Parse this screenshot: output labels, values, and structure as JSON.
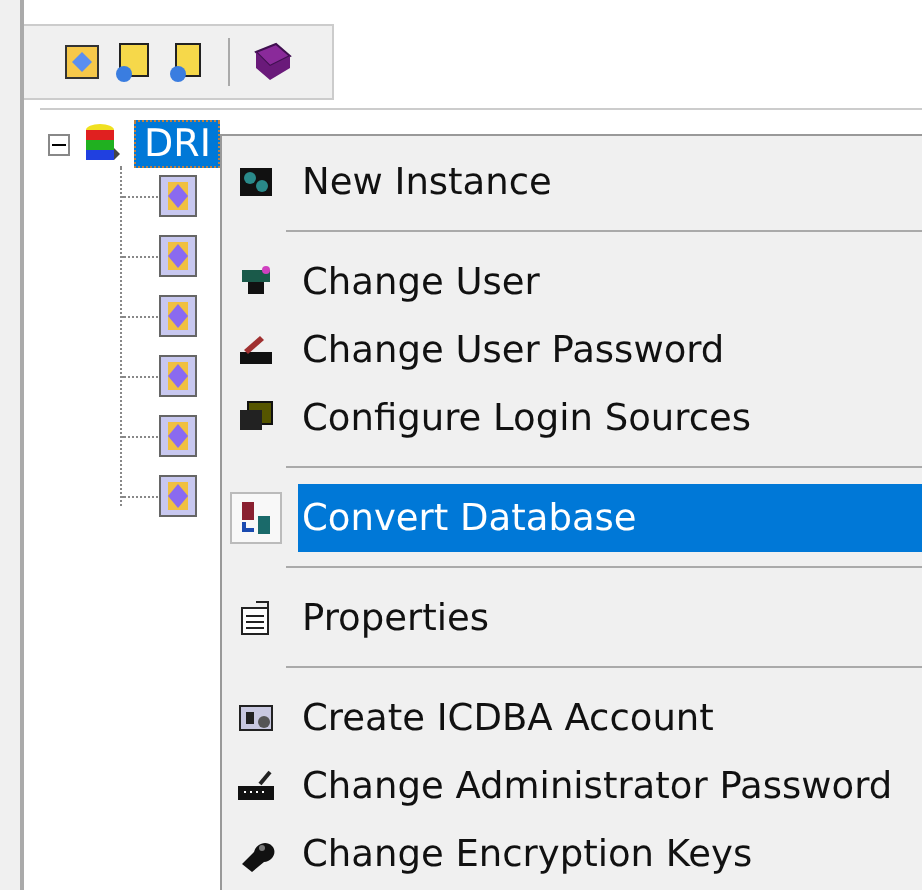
{
  "toolbar": {
    "buttons": [
      {
        "kind": "tool"
      },
      {
        "kind": "tool"
      },
      {
        "kind": "tool"
      },
      {
        "kind": "separator"
      },
      {
        "kind": "tool"
      }
    ]
  },
  "tree": {
    "root": {
      "label": "DRI",
      "selected": true,
      "expanded": true,
      "children": [
        {
          "kind": "instance"
        },
        {
          "kind": "instance"
        },
        {
          "kind": "instance"
        },
        {
          "kind": "instance"
        },
        {
          "kind": "instance"
        },
        {
          "kind": "instance"
        }
      ]
    }
  },
  "context_menu": {
    "items": [
      {
        "kind": "item",
        "label": "New Instance",
        "selected": false
      },
      {
        "kind": "separator"
      },
      {
        "kind": "item",
        "label": "Change User",
        "selected": false
      },
      {
        "kind": "item",
        "label": "Change User Password",
        "selected": false
      },
      {
        "kind": "item",
        "label": "Configure Login Sources",
        "selected": false
      },
      {
        "kind": "separator"
      },
      {
        "kind": "item",
        "label": "Convert Database",
        "selected": true
      },
      {
        "kind": "separator"
      },
      {
        "kind": "item",
        "label": "Properties",
        "selected": false
      },
      {
        "kind": "separator"
      },
      {
        "kind": "item",
        "label": "Create ICDBA Account",
        "selected": false
      },
      {
        "kind": "item",
        "label": "Change Administrator Password",
        "selected": false
      },
      {
        "kind": "item",
        "label": "Change Encryption Keys",
        "selected": false
      }
    ]
  }
}
